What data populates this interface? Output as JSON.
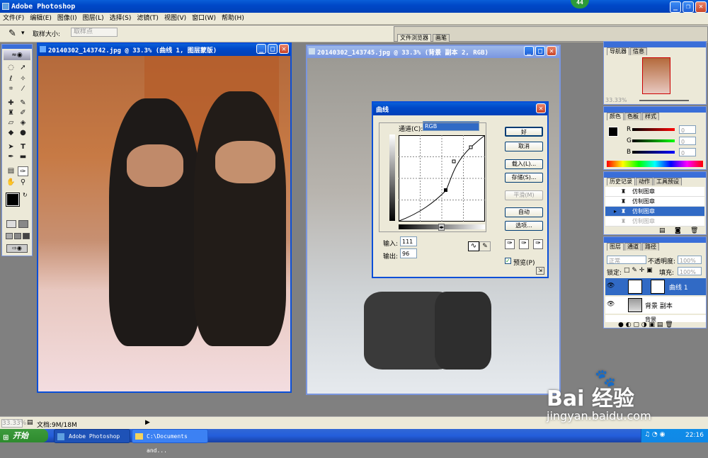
{
  "app": {
    "title": "Adobe Photoshop",
    "badge": "44"
  },
  "menu": [
    "文件(F)",
    "编辑(E)",
    "图像(I)",
    "图层(L)",
    "选择(S)",
    "滤镜(T)",
    "视图(V)",
    "窗口(W)",
    "帮助(H)"
  ],
  "options": {
    "label": "取样大小:",
    "value": "取样点",
    "tabs": [
      "文件浏览器",
      "画笔"
    ]
  },
  "doc1": {
    "title": "20140302_143742.jpg @ 33.3% (曲线 1, 图层蒙版)"
  },
  "doc2": {
    "title": "20140302_143745.jpg @ 33.3% (背景 副本 2, RGB)"
  },
  "curves": {
    "title": "曲线",
    "channel_label": "通道(C):",
    "channel_value": "RGB",
    "buttons": {
      "ok": "好",
      "cancel": "取消",
      "load": "载入(L)...",
      "save": "存储(S)...",
      "smooth": "平滑(M)",
      "auto": "自动",
      "options": "选项..."
    },
    "input_label": "输入:",
    "input_value": "111",
    "output_label": "输出:",
    "output_value": "96",
    "preview_label": "预览(P)"
  },
  "navigator": {
    "tabs": [
      "导航器",
      "信息"
    ],
    "zoom": "33.33%"
  },
  "color": {
    "tabs": [
      "颜色",
      "色板",
      "样式"
    ],
    "channels": [
      {
        "label": "R",
        "value": "0"
      },
      {
        "label": "G",
        "value": "0"
      },
      {
        "label": "B",
        "value": "0"
      }
    ]
  },
  "history": {
    "tabs": [
      "历史记录",
      "动作",
      "工具预设"
    ],
    "items": [
      "仿制图章",
      "仿制图章",
      "仿制图章",
      "仿制图章"
    ],
    "selected": 2
  },
  "layers": {
    "tabs": [
      "图层",
      "通道",
      "路径"
    ],
    "blend": "正常",
    "opacity_label": "不透明度:",
    "opacity": "100%",
    "lock_label": "锁定:",
    "fill_label": "填充:",
    "fill": "100%",
    "items": [
      {
        "name": "曲线 1"
      },
      {
        "name": "背景 副本"
      },
      {
        "name": "背景"
      }
    ]
  },
  "status": {
    "zoom": "33.33%",
    "doc": "文档:9M/18M"
  },
  "taskbar": {
    "start": "开始",
    "tasks": [
      "Adobe Photoshop",
      "C:\\Documents and..."
    ],
    "clock": "22:16"
  },
  "watermark": {
    "brand": "Bai 经验",
    "url": "jingyan.baidu.com"
  }
}
